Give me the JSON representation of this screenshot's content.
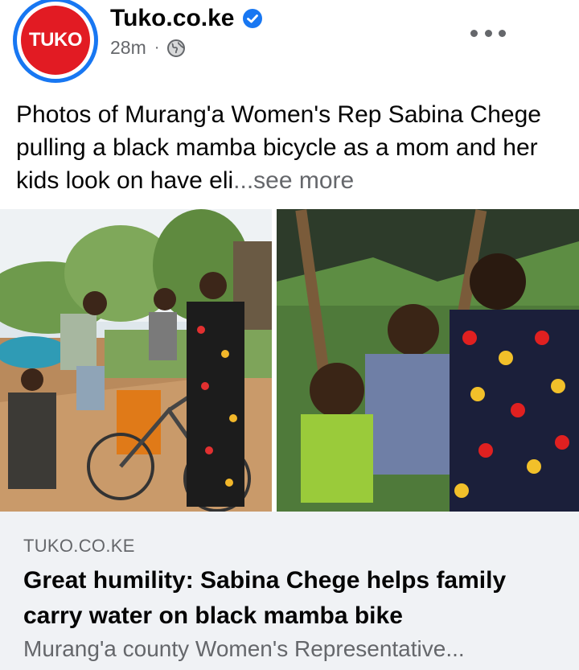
{
  "post": {
    "page_name": "Tuko.co.ke",
    "logo_text": "TUKO",
    "time": "28m",
    "separator": "·",
    "audience_icon": "globe-icon",
    "verified_icon": "verified-badge-icon",
    "more_icon": "more-options-icon",
    "text": "Photos of Murang'a Women's Rep Sabina Chege pulling a black mamba bicycle as a mom and her kids look on have eli",
    "see_more": "...see more"
  },
  "link_preview": {
    "domain": "TUKO.CO.KE",
    "title": "Great humility: Sabina Chege helps family carry water on black mamba bike",
    "description": "Murang'a county Women's Representative..."
  },
  "colors": {
    "brand_red": "#e21b23",
    "facebook_blue": "#1877f2",
    "secondary_text": "#65676b",
    "card_background": "#f0f2f5"
  }
}
